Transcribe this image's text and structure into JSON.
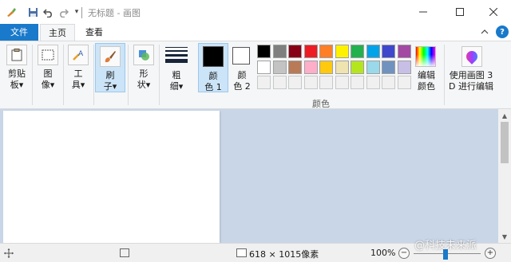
{
  "window": {
    "title": "无标题 - 画图",
    "minimize_icon": "minimize-icon",
    "maximize_icon": "maximize-icon",
    "close_icon": "close-icon"
  },
  "quick_access": {
    "app_icon": "paint-icon",
    "save_icon": "save-icon",
    "undo_icon": "undo-icon",
    "redo_icon": "redo-icon",
    "customize_icon": "dropdown-icon"
  },
  "tabs": [
    {
      "label": "文件",
      "active": false
    },
    {
      "label": "主页",
      "active": true
    },
    {
      "label": "查看",
      "active": false
    }
  ],
  "ribbon": {
    "clipboard": {
      "line1": "剪贴",
      "line2": "板▾",
      "icon": "clipboard-icon"
    },
    "image": {
      "line1": "图",
      "line2": "像▾",
      "icon": "image-icon"
    },
    "tools": {
      "line1": "工",
      "line2": "具▾",
      "icon": "tools-icon"
    },
    "brushes": {
      "line1": "刷",
      "line2": "子▾",
      "icon": "brush-icon"
    },
    "shapes": {
      "line1": "形",
      "line2": "状▾",
      "icon": "shapes-icon"
    },
    "size": {
      "line1": "粗",
      "line2": "细▾",
      "icon": "line-size-icon"
    },
    "color1": {
      "line1": "颜",
      "line2": "色 1",
      "color": "#000000"
    },
    "color2": {
      "line1": "颜",
      "line2": "色 2",
      "color": "#ffffff"
    },
    "edit_colors": {
      "line1": "编辑",
      "line2": "颜色",
      "icon": "color-spectrum-icon"
    },
    "paint3d": {
      "line1": "使用画图 3",
      "line2": "D 进行编辑",
      "icon": "paint3d-icon"
    },
    "colors_group_label": "颜色"
  },
  "palette": {
    "row1": [
      "#000000",
      "#7f7f7f",
      "#880015",
      "#ed1c24",
      "#ff7f27",
      "#fff200",
      "#22b14c",
      "#00a2e8",
      "#3f48cc",
      "#a349a4"
    ],
    "row2": [
      "#ffffff",
      "#c3c3c3",
      "#b97a57",
      "#ffaec9",
      "#ffc90e",
      "#efe4b0",
      "#b5e61d",
      "#99d9ea",
      "#7092be",
      "#c8bfe7"
    ],
    "row3": [
      "#f0f0f0",
      "#f0f0f0",
      "#f0f0f0",
      "#f0f0f0",
      "#f0f0f0",
      "#f0f0f0",
      "#f0f0f0",
      "#f0f0f0",
      "#f0f0f0",
      "#f0f0f0"
    ]
  },
  "status": {
    "cursor_icon": "move-cursor-icon",
    "selection_icon": "selection-icon",
    "canvas_size_icon": "canvas-size-icon",
    "canvas_size": "618 × 1015像素",
    "zoom": "100%",
    "zoom_out": "−",
    "zoom_in": "+",
    "zoom_level_percent": 100
  },
  "scroll": {
    "up_icon": "scroll-up-icon",
    "down_icon": "scroll-down-icon"
  },
  "watermark": "@科技未来派",
  "help_label": "?",
  "colors": {
    "accent": "#1979ca",
    "ribbon_bg": "#f5f6f7",
    "workspace_bg": "#c9d6e8"
  }
}
